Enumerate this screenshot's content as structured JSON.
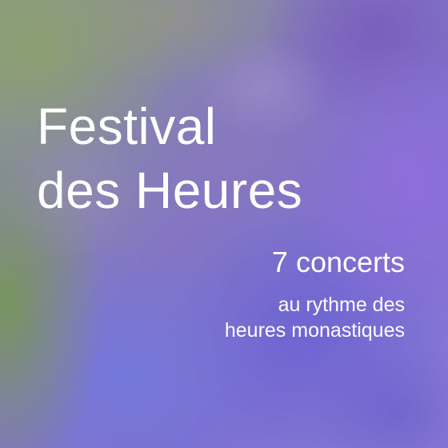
{
  "poster": {
    "title_line1": "Festival",
    "title_line2": "des Heures",
    "subtitle": "7 concerts",
    "tagline_line1": "au rythme des",
    "tagline_line2": "heures monastiques"
  },
  "colors": {
    "text": "#ffffff",
    "background_primary": "#7c6fd0",
    "background_accent_green": "#8ca06e"
  }
}
